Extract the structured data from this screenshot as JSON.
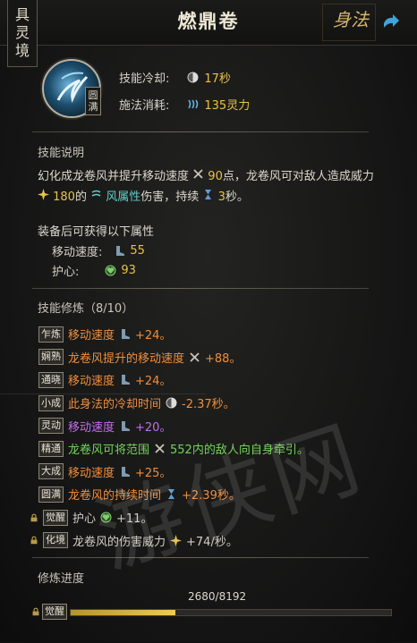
{
  "header": {
    "realm_badge": [
      "具",
      "灵",
      "境"
    ],
    "title": "燃鼎卷",
    "calligraphy": "身法"
  },
  "skill": {
    "icon_name": "wind-skill-icon",
    "grade_badge": [
      "圆",
      "满"
    ],
    "cooldown_label": "技能冷却:",
    "cooldown_value": "17秒",
    "cost_label": "施法消耗:",
    "cost_value": "135灵力"
  },
  "description": {
    "section_title": "技能说明",
    "line1_a": "幻化成龙卷风并提升移动速度",
    "line1_val": "90",
    "line1_b": "点，龙卷风可对敌人造成威力",
    "line2_val": "180",
    "line2_a": "的",
    "line2_elem": "风属性",
    "line2_b": "伤害，持续",
    "line2_dur": "3",
    "line2_c": "秒。"
  },
  "equip": {
    "title": "装备后可获得以下属性",
    "items": [
      {
        "label": "移动速度:",
        "value": "55",
        "icon": "boot-icon"
      },
      {
        "label": "护心:",
        "value": "93",
        "icon": "heart-icon"
      }
    ]
  },
  "training": {
    "section_title": "技能修炼（8/10）",
    "rows": [
      {
        "tag": "乍炼",
        "text": "移动速度",
        "icon": "boot-icon",
        "value": "+24。",
        "color": "orange"
      },
      {
        "tag": "娴熟",
        "text": "龙卷风提升的移动速度",
        "icon": "cross-arrows-icon",
        "value": "+88。",
        "color": "orange"
      },
      {
        "tag": "通晓",
        "text": "移动速度",
        "icon": "boot-icon",
        "value": "+24。",
        "color": "orange"
      },
      {
        "tag": "小成",
        "text": "此身法的冷却时间",
        "icon": "cooldown-icon",
        "value": "-2.37秒。",
        "color": "orange"
      },
      {
        "tag": "灵动",
        "text": "移动速度",
        "icon": "boot-icon",
        "value": "+20。",
        "color": "purple"
      },
      {
        "tag": "精通",
        "text": "龙卷风可将范围",
        "icon": "cross-arrows-icon",
        "value": "552内的敌人向自身牵引。",
        "color": "green"
      },
      {
        "tag": "大成",
        "text": "移动速度",
        "icon": "boot-icon",
        "value": "+25。",
        "color": "orange"
      },
      {
        "tag": "圆满",
        "text": "龙卷风的持续时间",
        "icon": "hourglass-icon",
        "value": "+2.39秒。",
        "color": "orange"
      },
      {
        "tag": "觉醒",
        "text": "护心",
        "icon": "heart-icon",
        "value": "+11。",
        "color": "gray",
        "locked": true
      },
      {
        "tag": "化境",
        "text": "龙卷风的伤害威力",
        "icon": "burst-icon",
        "value": "+74/秒。",
        "color": "gray",
        "locked": true
      }
    ]
  },
  "progress": {
    "section_title": "修炼进度",
    "value_text": "2680/8192",
    "fraction": 0.327,
    "start_tag": "觉醒"
  },
  "colors": {
    "orange": "#f08e3c",
    "purple": "#c46cf0",
    "green": "#74d35a",
    "yellow": "#e8c347",
    "cyan": "#5fd0c6"
  }
}
